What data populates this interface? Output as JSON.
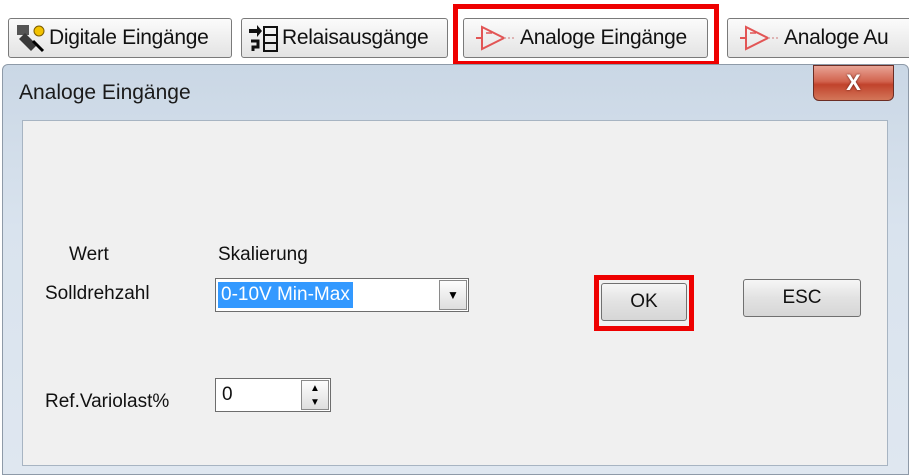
{
  "toolbar": {
    "tabs": [
      {
        "label": "Digitale Eingänge",
        "icon": "digital-input-icon"
      },
      {
        "label": "Relaisausgänge",
        "icon": "relay-output-icon"
      },
      {
        "label": "Analoge Eingänge",
        "icon": "analog-input-icon"
      },
      {
        "label": "Analoge Au",
        "icon": "analog-output-icon"
      }
    ]
  },
  "dialog": {
    "title": "Analoge Eingänge",
    "close_label": "X",
    "headers": {
      "value": "Wert",
      "scaling": "Skalierung"
    },
    "rows": [
      {
        "label": "Solldrehzahl",
        "control": "combo",
        "value": "0-10V Min-Max"
      },
      {
        "label": "Ref.Variolast%",
        "control": "spin",
        "value": "0"
      }
    ],
    "buttons": {
      "ok": "OK",
      "esc": "ESC"
    }
  },
  "colors": {
    "highlight": "#ee0000",
    "selection": "#3399ff",
    "close_button": "#c1432c"
  }
}
